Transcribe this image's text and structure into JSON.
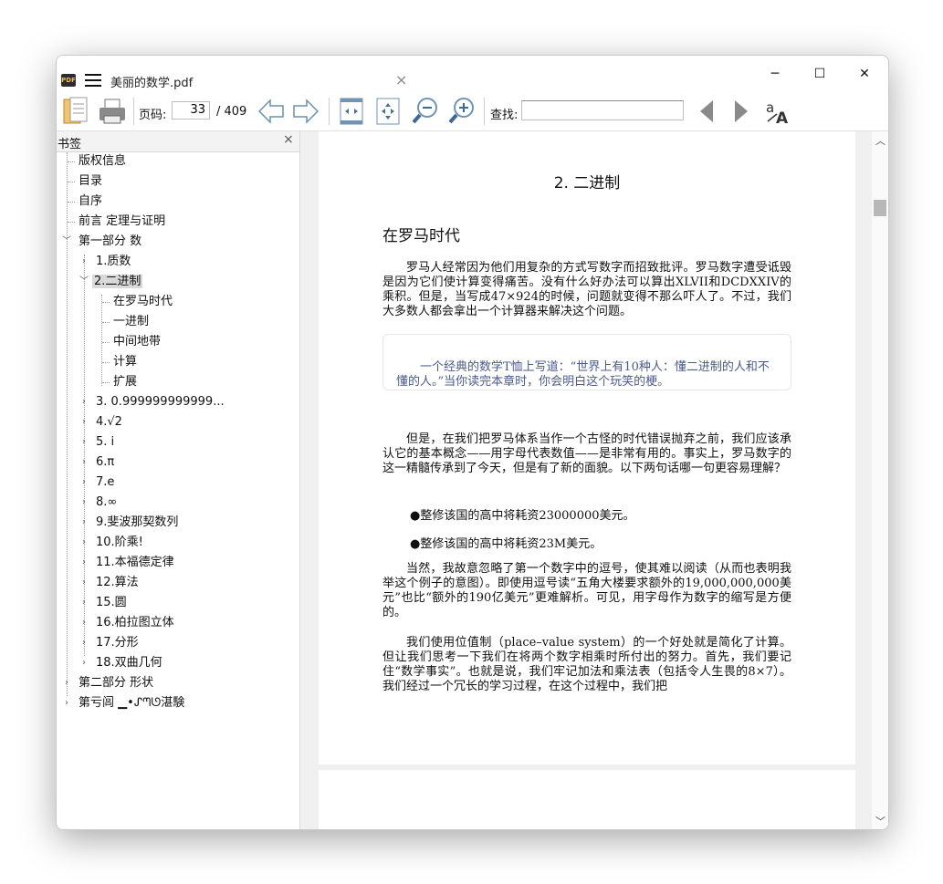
{
  "window": {
    "tab_title": "美丽的数学.pdf",
    "tab_close": "×",
    "minimize": "─",
    "maximize": "☐",
    "close": "✕"
  },
  "toolbar": {
    "page_label": "页码:",
    "current_page": "33",
    "total_pages": "/ 409",
    "find_label": "查找:",
    "find_value": ""
  },
  "sidebar": {
    "title": "书签",
    "close": "×",
    "items": [
      {
        "label": "版权信息"
      },
      {
        "label": "目录"
      },
      {
        "label": "自序"
      },
      {
        "label": "前言 定理与证明"
      },
      {
        "label": "第一部分 数"
      },
      {
        "label": "1.质数"
      },
      {
        "label": "2.二进制"
      },
      {
        "label": "在罗马时代"
      },
      {
        "label": "一进制"
      },
      {
        "label": "中间地带"
      },
      {
        "label": "计算"
      },
      {
        "label": "扩展"
      },
      {
        "label": "3. 0.999999999999..."
      },
      {
        "label": "4.√2"
      },
      {
        "label": "5. i"
      },
      {
        "label": "6.π"
      },
      {
        "label": "7.e"
      },
      {
        "label": "8.∞"
      },
      {
        "label": "9.斐波那契数列"
      },
      {
        "label": "10.阶乘!"
      },
      {
        "label": "11.本福德定律"
      },
      {
        "label": "12.算法"
      },
      {
        "label": "15.圆"
      },
      {
        "label": "16.柏拉图立体"
      },
      {
        "label": "17.分形"
      },
      {
        "label": "18.双曲几何"
      },
      {
        "label": "第二部分 形状"
      },
      {
        "label": "第亏闾 ▁•ᔑᘉᘎ湛験"
      }
    ]
  },
  "document": {
    "chapter_title": "2. 二进制",
    "section_title": "在罗马时代",
    "p1": "罗马人经常因为他们用复杂的方式写数字而招致批评。罗马数字遭受诋毁是因为它们使计算变得痛苦。没有什么好办法可以算出XLVII和DCDXXIV的乘积。但是，当写成47×924的时候，问题就变得不那么吓人了。不过，我们大多数人都会拿出一个计算器来解决这个问题。",
    "quote": "一个经典的数学T恤上写道：“世界上有10种人：懂二进制的人和不懂的人。”当你读完本章时，你会明白这个玩笑的梗。",
    "p2": "但是，在我们把罗马体系当作一个古怪的时代错误抛弃之前，我们应该承认它的基本概念——用字母代表数值——是非常有用的。事实上，罗马数字的这一精髓传承到了今天，但是有了新的面貌。以下两句话哪一句更容易理解？",
    "b1": "●整修该国的高中将耗资23000000美元。",
    "b2": "●整修该国的高中将耗资23M美元。",
    "p3": "当然，我故意忽略了第一个数字中的逗号，使其难以阅读（从而也表明我举这个例子的意图）。即使用逗号读“五角大楼要求额外的19,000,000,000美元”也比“额外的190亿美元”更难解析。可见，用字母作为数字的缩写是方便的。",
    "p4": "我们使用位值制（place–value system）的一个好处就是简化了计算。但让我们思考一下我们在将两个数字相乘时所付出的努力。首先，我们要记住“数学事实”。也就是说，我们牢记加法和乘法表（包括令人生畏的8×7）。我们经过一个冗长的学习过程，在这个过程中，我们把"
  }
}
